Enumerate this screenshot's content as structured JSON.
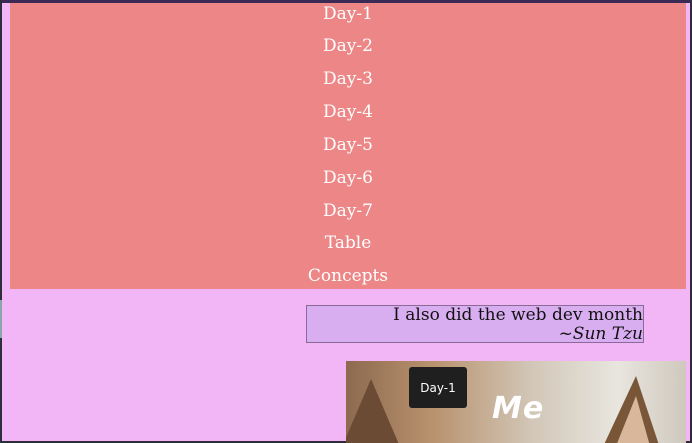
{
  "nav": {
    "items": [
      "Day-1",
      "Day-2",
      "Day-3",
      "Day-4",
      "Day-5",
      "Day-6",
      "Day-7",
      "Table",
      "Concepts"
    ]
  },
  "quote": {
    "text": "I also did the web dev month",
    "author": "~Sun Tzu"
  },
  "image": {
    "caption": "Me"
  },
  "tooltip": {
    "text": "Day-1"
  },
  "colors": {
    "page_bg": "#f2b6f7",
    "nav_bg": "#ed8787",
    "quote_bg": "#d9aef1",
    "tooltip_bg": "#1f1f1f"
  }
}
